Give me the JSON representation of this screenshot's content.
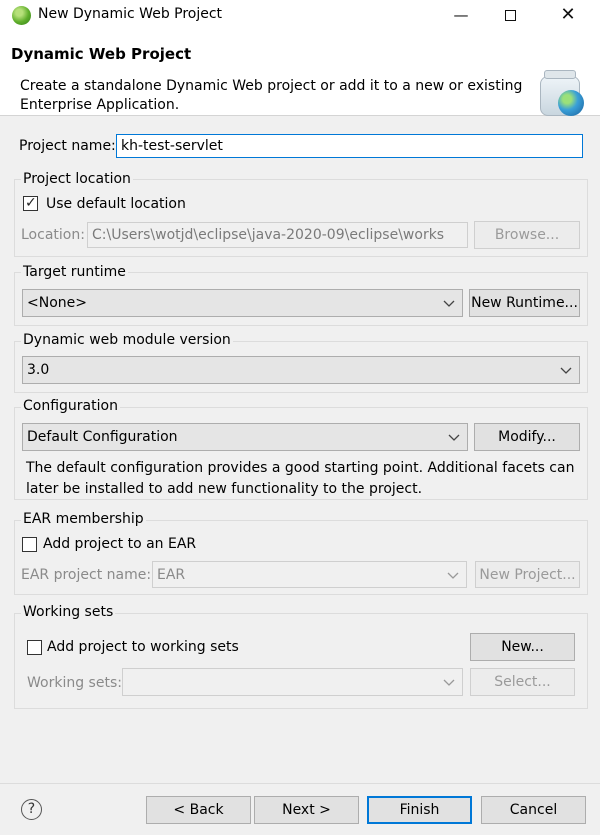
{
  "window": {
    "title": "New Dynamic Web Project",
    "minimize": "—",
    "close": "✕"
  },
  "banner": {
    "title": "Dynamic Web Project",
    "description": "Create a standalone Dynamic Web project or add it to a new or existing Enterprise Application."
  },
  "project_name": {
    "label": "Project name:",
    "value": "kh-test-servlet"
  },
  "project_location": {
    "group_title": "Project location",
    "use_default_label": "Use default location",
    "use_default_checked": true,
    "location_label": "Location:",
    "location_value": "C:\\Users\\wotjd\\eclipse\\java-2020-09\\eclipse\\works",
    "browse_label": "Browse..."
  },
  "target_runtime": {
    "group_title": "Target runtime",
    "selected": "<None>",
    "new_runtime_label": "New Runtime..."
  },
  "web_module": {
    "group_title": "Dynamic web module version",
    "selected": "3.0"
  },
  "configuration": {
    "group_title": "Configuration",
    "selected": "Default Configuration",
    "modify_label": "Modify...",
    "description": "The default configuration provides a good starting point. Additional facets can later be installed to add new functionality to the project."
  },
  "ear": {
    "group_title": "EAR membership",
    "add_label": "Add project to an EAR",
    "add_checked": false,
    "project_name_label": "EAR project name:",
    "project_name_value": "EAR",
    "new_project_label": "New Project..."
  },
  "working_sets": {
    "group_title": "Working sets",
    "add_label": "Add project to working sets",
    "add_checked": false,
    "new_label": "New...",
    "sets_label": "Working sets:",
    "sets_value": "",
    "select_label": "Select..."
  },
  "footer": {
    "help": "?",
    "back_label": "< Back",
    "next_label": "Next >",
    "finish_label": "Finish",
    "cancel_label": "Cancel"
  },
  "icons": {
    "app": "eclipse-icon",
    "wizard": "web-project-wizard-icon",
    "help": "help-icon"
  }
}
